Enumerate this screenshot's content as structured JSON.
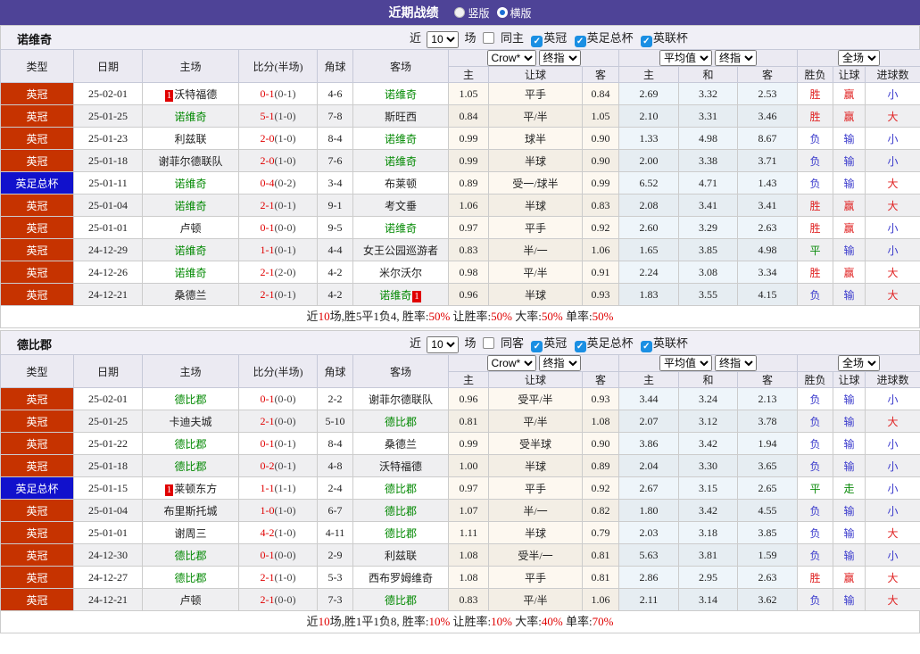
{
  "title_bar": {
    "title": "近期战绩",
    "options": [
      {
        "label": "竖版",
        "selected": false
      },
      {
        "label": "横版",
        "selected": true
      }
    ],
    "bar_color": "#4E4397"
  },
  "controls": {
    "near": "近",
    "games": "10",
    "unit": "场",
    "filters": [
      "英冠",
      "英足总杯",
      "英联杯"
    ]
  },
  "columns": {
    "type": "类型",
    "date": "日期",
    "home": "主场",
    "score": "比分(半场)",
    "corners": "角球",
    "away": "客场",
    "asia_dd1": "Crow*",
    "asia_dd2": "终指",
    "euro_dd1": "平均值",
    "euro_dd2": "终指",
    "full_dd": "全场",
    "sub": [
      "主",
      "让球",
      "客",
      "主",
      "和",
      "客",
      "胜负",
      "让球",
      "进球数"
    ]
  },
  "colors": {
    "league_badge": "#C63300",
    "cup_badge": "#1111CC",
    "focus_team": "#008800",
    "win_red": "#E02222",
    "lose_blue": "#3A3ACC",
    "draw_green": "#0B8B0B",
    "score_red": "#E00000"
  },
  "tables": [
    {
      "team": "诺维奇",
      "same_label": "同主",
      "rows": [
        {
          "comp": "英冠",
          "comp_style": "lg",
          "date": "25-02-01",
          "home": {
            "name": "沃特福德",
            "focus": false,
            "badge": "1",
            "badge_pos": "before"
          },
          "score_ft": "0-1",
          "score_ht": "(0-1)",
          "corners": "4-6",
          "away": {
            "name": "诺维奇",
            "focus": true
          },
          "odds": [
            "1.05",
            "平手",
            "0.84"
          ],
          "euro": [
            "2.69",
            "3.32",
            "2.53"
          ],
          "results": [
            [
              "胜",
              "r"
            ],
            [
              "赢",
              "r"
            ],
            [
              "小",
              "b"
            ]
          ]
        },
        {
          "comp": "英冠",
          "comp_style": "lg",
          "date": "25-01-25",
          "home": {
            "name": "诺维奇",
            "focus": true
          },
          "score_ft": "5-1",
          "score_ht": "(1-0)",
          "corners": "7-8",
          "away": {
            "name": "斯旺西",
            "focus": false
          },
          "odds": [
            "0.84",
            "平/半",
            "1.05"
          ],
          "euro": [
            "2.10",
            "3.31",
            "3.46"
          ],
          "results": [
            [
              "胜",
              "r"
            ],
            [
              "赢",
              "r"
            ],
            [
              "大",
              "r"
            ]
          ]
        },
        {
          "comp": "英冠",
          "comp_style": "lg",
          "date": "25-01-23",
          "home": {
            "name": "利兹联",
            "focus": false
          },
          "score_ft": "2-0",
          "score_ht": "(1-0)",
          "corners": "8-4",
          "away": {
            "name": "诺维奇",
            "focus": true
          },
          "odds": [
            "0.99",
            "球半",
            "0.90"
          ],
          "euro": [
            "1.33",
            "4.98",
            "8.67"
          ],
          "results": [
            [
              "负",
              "b"
            ],
            [
              "输",
              "b"
            ],
            [
              "小",
              "b"
            ]
          ]
        },
        {
          "comp": "英冠",
          "comp_style": "lg",
          "date": "25-01-18",
          "home": {
            "name": "谢菲尔德联队",
            "focus": false
          },
          "score_ft": "2-0",
          "score_ht": "(1-0)",
          "corners": "7-6",
          "away": {
            "name": "诺维奇",
            "focus": true
          },
          "odds": [
            "0.99",
            "半球",
            "0.90"
          ],
          "euro": [
            "2.00",
            "3.38",
            "3.71"
          ],
          "results": [
            [
              "负",
              "b"
            ],
            [
              "输",
              "b"
            ],
            [
              "小",
              "b"
            ]
          ]
        },
        {
          "comp": "英足总杯",
          "comp_style": "fa",
          "date": "25-01-11",
          "home": {
            "name": "诺维奇",
            "focus": true
          },
          "score_ft": "0-4",
          "score_ht": "(0-2)",
          "corners": "3-4",
          "away": {
            "name": "布莱顿",
            "focus": false
          },
          "odds": [
            "0.89",
            "受一/球半",
            "0.99"
          ],
          "euro": [
            "6.52",
            "4.71",
            "1.43"
          ],
          "results": [
            [
              "负",
              "b"
            ],
            [
              "输",
              "b"
            ],
            [
              "大",
              "r"
            ]
          ]
        },
        {
          "comp": "英冠",
          "comp_style": "lg",
          "date": "25-01-04",
          "home": {
            "name": "诺维奇",
            "focus": true
          },
          "score_ft": "2-1",
          "score_ht": "(0-1)",
          "corners": "9-1",
          "away": {
            "name": "考文垂",
            "focus": false
          },
          "odds": [
            "1.06",
            "半球",
            "0.83"
          ],
          "euro": [
            "2.08",
            "3.41",
            "3.41"
          ],
          "results": [
            [
              "胜",
              "r"
            ],
            [
              "赢",
              "r"
            ],
            [
              "大",
              "r"
            ]
          ]
        },
        {
          "comp": "英冠",
          "comp_style": "lg",
          "date": "25-01-01",
          "home": {
            "name": "卢顿",
            "focus": false
          },
          "score_ft": "0-1",
          "score_ht": "(0-0)",
          "corners": "9-5",
          "away": {
            "name": "诺维奇",
            "focus": true
          },
          "odds": [
            "0.97",
            "平手",
            "0.92"
          ],
          "euro": [
            "2.60",
            "3.29",
            "2.63"
          ],
          "results": [
            [
              "胜",
              "r"
            ],
            [
              "赢",
              "r"
            ],
            [
              "小",
              "b"
            ]
          ]
        },
        {
          "comp": "英冠",
          "comp_style": "lg",
          "date": "24-12-29",
          "home": {
            "name": "诺维奇",
            "focus": true
          },
          "score_ft": "1-1",
          "score_ht": "(0-1)",
          "corners": "4-4",
          "away": {
            "name": "女王公园巡游者",
            "focus": false
          },
          "odds": [
            "0.83",
            "半/一",
            "1.06"
          ],
          "euro": [
            "1.65",
            "3.85",
            "4.98"
          ],
          "results": [
            [
              "平",
              "g"
            ],
            [
              "输",
              "b"
            ],
            [
              "小",
              "b"
            ]
          ]
        },
        {
          "comp": "英冠",
          "comp_style": "lg",
          "date": "24-12-26",
          "home": {
            "name": "诺维奇",
            "focus": true
          },
          "score_ft": "2-1",
          "score_ht": "(2-0)",
          "corners": "4-2",
          "away": {
            "name": "米尔沃尔",
            "focus": false
          },
          "odds": [
            "0.98",
            "平/半",
            "0.91"
          ],
          "euro": [
            "2.24",
            "3.08",
            "3.34"
          ],
          "results": [
            [
              "胜",
              "r"
            ],
            [
              "赢",
              "r"
            ],
            [
              "大",
              "r"
            ]
          ]
        },
        {
          "comp": "英冠",
          "comp_style": "lg",
          "date": "24-12-21",
          "home": {
            "name": "桑德兰",
            "focus": false
          },
          "score_ft": "2-1",
          "score_ht": "(0-1)",
          "corners": "4-2",
          "away": {
            "name": "诺维奇",
            "focus": true,
            "badge": "1",
            "badge_pos": "after"
          },
          "odds": [
            "0.96",
            "半球",
            "0.93"
          ],
          "euro": [
            "1.83",
            "3.55",
            "4.15"
          ],
          "results": [
            [
              "负",
              "b"
            ],
            [
              "输",
              "b"
            ],
            [
              "大",
              "r"
            ]
          ]
        }
      ],
      "summary": [
        [
          "近",
          "k"
        ],
        [
          "10",
          "r"
        ],
        [
          "场,胜5平1负4, 胜率:",
          "k"
        ],
        [
          "50%",
          "r"
        ],
        [
          " 让胜率:",
          "k"
        ],
        [
          "50%",
          "r"
        ],
        [
          " 大率:",
          "k"
        ],
        [
          "50%",
          "r"
        ],
        [
          " 单率:",
          "k"
        ],
        [
          "50%",
          "r"
        ]
      ]
    },
    {
      "team": "德比郡",
      "same_label": "同客",
      "rows": [
        {
          "comp": "英冠",
          "comp_style": "lg",
          "date": "25-02-01",
          "home": {
            "name": "德比郡",
            "focus": true
          },
          "score_ft": "0-1",
          "score_ht": "(0-0)",
          "corners": "2-2",
          "away": {
            "name": "谢菲尔德联队",
            "focus": false
          },
          "odds": [
            "0.96",
            "受平/半",
            "0.93"
          ],
          "euro": [
            "3.44",
            "3.24",
            "2.13"
          ],
          "results": [
            [
              "负",
              "b"
            ],
            [
              "输",
              "b"
            ],
            [
              "小",
              "b"
            ]
          ]
        },
        {
          "comp": "英冠",
          "comp_style": "lg",
          "date": "25-01-25",
          "home": {
            "name": "卡迪夫城",
            "focus": false
          },
          "score_ft": "2-1",
          "score_ht": "(0-0)",
          "corners": "5-10",
          "away": {
            "name": "德比郡",
            "focus": true
          },
          "odds": [
            "0.81",
            "平/半",
            "1.08"
          ],
          "euro": [
            "2.07",
            "3.12",
            "3.78"
          ],
          "results": [
            [
              "负",
              "b"
            ],
            [
              "输",
              "b"
            ],
            [
              "大",
              "r"
            ]
          ]
        },
        {
          "comp": "英冠",
          "comp_style": "lg",
          "date": "25-01-22",
          "home": {
            "name": "德比郡",
            "focus": true
          },
          "score_ft": "0-1",
          "score_ht": "(0-1)",
          "corners": "8-4",
          "away": {
            "name": "桑德兰",
            "focus": false
          },
          "odds": [
            "0.99",
            "受半球",
            "0.90"
          ],
          "euro": [
            "3.86",
            "3.42",
            "1.94"
          ],
          "results": [
            [
              "负",
              "b"
            ],
            [
              "输",
              "b"
            ],
            [
              "小",
              "b"
            ]
          ]
        },
        {
          "comp": "英冠",
          "comp_style": "lg",
          "date": "25-01-18",
          "home": {
            "name": "德比郡",
            "focus": true
          },
          "score_ft": "0-2",
          "score_ht": "(0-1)",
          "corners": "4-8",
          "away": {
            "name": "沃特福德",
            "focus": false
          },
          "odds": [
            "1.00",
            "半球",
            "0.89"
          ],
          "euro": [
            "2.04",
            "3.30",
            "3.65"
          ],
          "results": [
            [
              "负",
              "b"
            ],
            [
              "输",
              "b"
            ],
            [
              "小",
              "b"
            ]
          ]
        },
        {
          "comp": "英足总杯",
          "comp_style": "fa",
          "date": "25-01-15",
          "home": {
            "name": "莱顿东方",
            "focus": false,
            "badge": "1",
            "badge_pos": "before"
          },
          "score_ft": "1-1",
          "score_ht": "(1-1)",
          "corners": "2-4",
          "away": {
            "name": "德比郡",
            "focus": true
          },
          "odds": [
            "0.97",
            "平手",
            "0.92"
          ],
          "euro": [
            "2.67",
            "3.15",
            "2.65"
          ],
          "results": [
            [
              "平",
              "g"
            ],
            [
              "走",
              "g"
            ],
            [
              "小",
              "b"
            ]
          ]
        },
        {
          "comp": "英冠",
          "comp_style": "lg",
          "date": "25-01-04",
          "home": {
            "name": "布里斯托城",
            "focus": false
          },
          "score_ft": "1-0",
          "score_ht": "(1-0)",
          "corners": "6-7",
          "away": {
            "name": "德比郡",
            "focus": true
          },
          "odds": [
            "1.07",
            "半/一",
            "0.82"
          ],
          "euro": [
            "1.80",
            "3.42",
            "4.55"
          ],
          "results": [
            [
              "负",
              "b"
            ],
            [
              "输",
              "b"
            ],
            [
              "小",
              "b"
            ]
          ]
        },
        {
          "comp": "英冠",
          "comp_style": "lg",
          "date": "25-01-01",
          "home": {
            "name": "谢周三",
            "focus": false
          },
          "score_ft": "4-2",
          "score_ht": "(1-0)",
          "corners": "4-11",
          "away": {
            "name": "德比郡",
            "focus": true
          },
          "odds": [
            "1.11",
            "半球",
            "0.79"
          ],
          "euro": [
            "2.03",
            "3.18",
            "3.85"
          ],
          "results": [
            [
              "负",
              "b"
            ],
            [
              "输",
              "b"
            ],
            [
              "大",
              "r"
            ]
          ]
        },
        {
          "comp": "英冠",
          "comp_style": "lg",
          "date": "24-12-30",
          "home": {
            "name": "德比郡",
            "focus": true
          },
          "score_ft": "0-1",
          "score_ht": "(0-0)",
          "corners": "2-9",
          "away": {
            "name": "利兹联",
            "focus": false
          },
          "odds": [
            "1.08",
            "受半/一",
            "0.81"
          ],
          "euro": [
            "5.63",
            "3.81",
            "1.59"
          ],
          "results": [
            [
              "负",
              "b"
            ],
            [
              "输",
              "b"
            ],
            [
              "小",
              "b"
            ]
          ]
        },
        {
          "comp": "英冠",
          "comp_style": "lg",
          "date": "24-12-27",
          "home": {
            "name": "德比郡",
            "focus": true
          },
          "score_ft": "2-1",
          "score_ht": "(1-0)",
          "corners": "5-3",
          "away": {
            "name": "西布罗姆维奇",
            "focus": false
          },
          "odds": [
            "1.08",
            "平手",
            "0.81"
          ],
          "euro": [
            "2.86",
            "2.95",
            "2.63"
          ],
          "results": [
            [
              "胜",
              "r"
            ],
            [
              "赢",
              "r"
            ],
            [
              "大",
              "r"
            ]
          ]
        },
        {
          "comp": "英冠",
          "comp_style": "lg",
          "date": "24-12-21",
          "home": {
            "name": "卢顿",
            "focus": false
          },
          "score_ft": "2-1",
          "score_ht": "(0-0)",
          "corners": "7-3",
          "away": {
            "name": "德比郡",
            "focus": true
          },
          "odds": [
            "0.83",
            "平/半",
            "1.06"
          ],
          "euro": [
            "2.11",
            "3.14",
            "3.62"
          ],
          "results": [
            [
              "负",
              "b"
            ],
            [
              "输",
              "b"
            ],
            [
              "大",
              "r"
            ]
          ]
        }
      ],
      "summary": [
        [
          "近",
          "k"
        ],
        [
          "10",
          "r"
        ],
        [
          "场,胜1平1负8, 胜率:",
          "k"
        ],
        [
          "10%",
          "r"
        ],
        [
          " 让胜率:",
          "k"
        ],
        [
          "10%",
          "r"
        ],
        [
          " 大率:",
          "k"
        ],
        [
          "40%",
          "r"
        ],
        [
          " 单率:",
          "k"
        ],
        [
          "70%",
          "r"
        ]
      ]
    }
  ]
}
